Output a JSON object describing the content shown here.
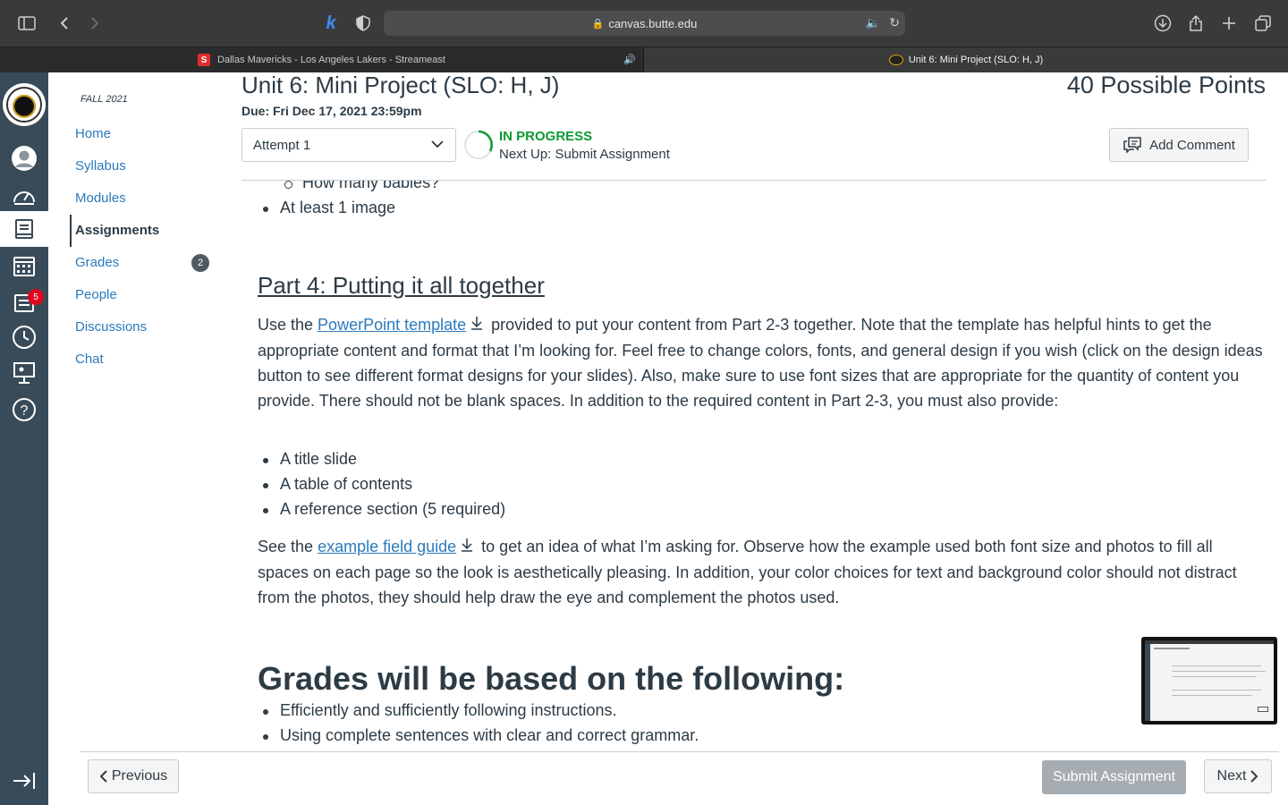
{
  "browser": {
    "url": "canvas.butte.edu",
    "tabs": [
      {
        "label": "Dallas Mavericks - Los Angeles Lakers - Streameast",
        "favicon": "S"
      },
      {
        "label": "Unit 6: Mini Project (SLO: H, J)"
      }
    ]
  },
  "global_nav": {
    "badge_count": "5",
    "icons": [
      "account-icon",
      "dashboard-icon",
      "courses-icon",
      "calendar-icon",
      "inbox-icon",
      "history-icon",
      "studio-icon",
      "help-icon"
    ]
  },
  "course_nav": {
    "term": "FALL 2021",
    "items": [
      {
        "label": "Home"
      },
      {
        "label": "Syllabus"
      },
      {
        "label": "Modules"
      },
      {
        "label": "Assignments"
      },
      {
        "label": "Grades",
        "badge": "2"
      },
      {
        "label": "People"
      },
      {
        "label": "Discussions"
      },
      {
        "label": "Chat"
      }
    ]
  },
  "assignment": {
    "title": "Unit 6: Mini Project (SLO: H, J)",
    "points": "40 Possible Points",
    "due": "Due: Fri Dec 17, 2021 23:59pm",
    "attempt": "Attempt 1",
    "status": "IN PROGRESS",
    "next_up": "Next Up: Submit Assignment",
    "add_comment": "Add Comment"
  },
  "content": {
    "sub_bullet": "How many babies?",
    "bullet_image": "At least 1 image",
    "part4_heading": "Part 4: Putting it all together",
    "para1_pre": "Use the ",
    "para1_link": "PowerPoint template",
    "para1_post": "provided to put your content from Part 2-3 together. Note that the template has helpful hints to get the appropriate content and format that I’m looking for. Feel free to change colors, fonts, and general design if you wish (click on the design ideas button to see different format designs for your slides). Also, make sure to use font sizes that are appropriate for the quantity of content you provide. There should not be blank spaces. In addition to the required content in Part 2-3, you must also provide:",
    "bullets": [
      "A title slide",
      "A table of contents",
      "A reference section (5 required)"
    ],
    "para2_pre": "See the ",
    "para2_link": "example field guide",
    "para2_post": "to get an idea of what I’m asking for. Observe how the example used both font size and photos to fill all spaces on each page so the look is aesthetically pleasing. In addition, your color choices for text and background color should not distract from the photos, they should help draw the eye and complement the photos used.",
    "grades_heading": "Grades will be based on the following:",
    "grades_bullets": [
      "Efficiently and sufficiently following instructions.",
      "Using complete sentences with clear and correct grammar."
    ]
  },
  "footer": {
    "previous": "Previous",
    "submit": "Submit Assignment",
    "next": "Next"
  },
  "colors": {
    "link": "#2b7abc",
    "status_green": "#0b9b36",
    "global_nav": "#394b58"
  }
}
